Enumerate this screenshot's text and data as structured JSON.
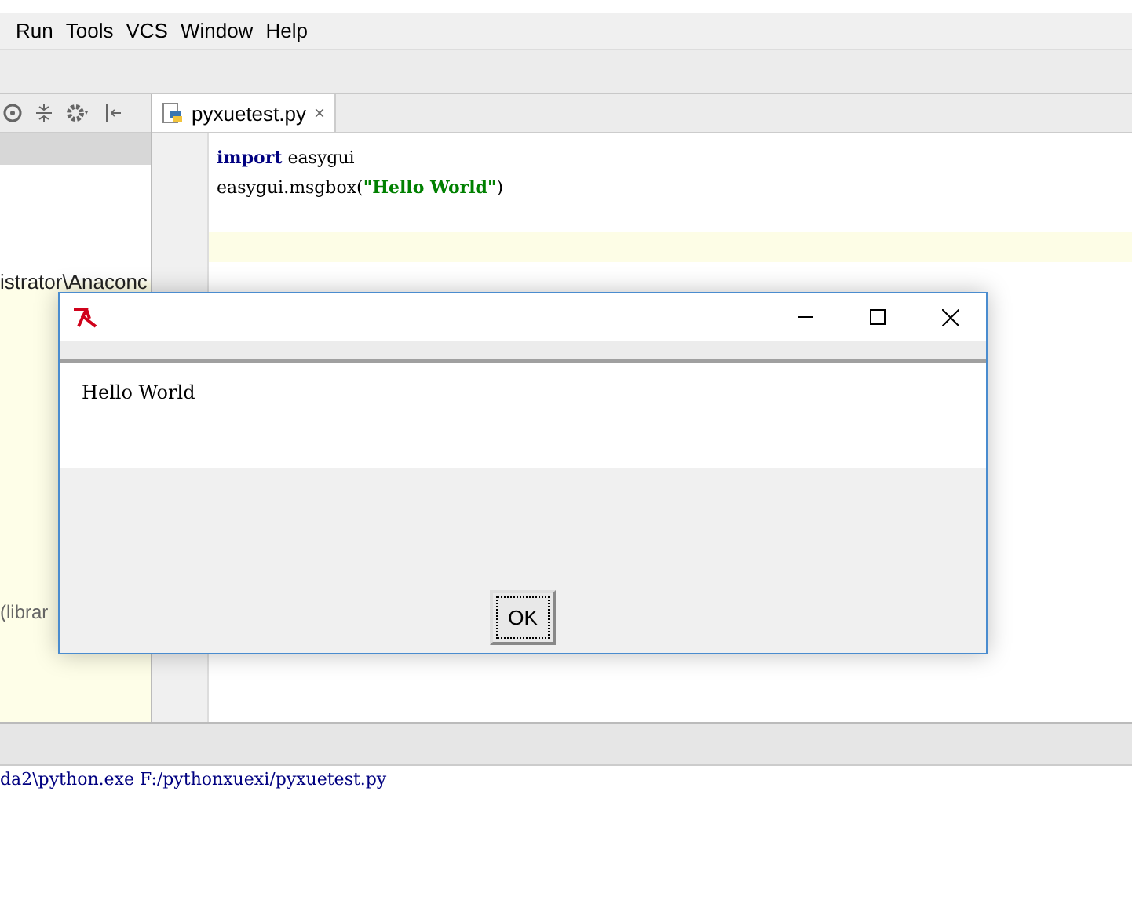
{
  "menu_bar": {
    "items": [
      "Run",
      "Tools",
      "VCS",
      "Window",
      "Help"
    ]
  },
  "editor_tabs": [
    {
      "label": "pyxuetest.py",
      "close": "×",
      "selected": true
    }
  ],
  "project_panel": {
    "lines": [
      "istrator\\Anaconc",
      "(librar"
    ]
  },
  "editor": {
    "lines": [
      {
        "keyword": "import",
        "rest": " easygui"
      },
      {
        "rest": "easygui.msgbox(",
        "string": "\"Hello World\"",
        "tail": ")"
      }
    ]
  },
  "run_console": {
    "lines": [
      "da2\\python.exe F:/pythonxuexi/pyxuetest.py"
    ]
  },
  "dialog": {
    "message": "Hello World",
    "buttons": [
      "OK"
    ]
  }
}
